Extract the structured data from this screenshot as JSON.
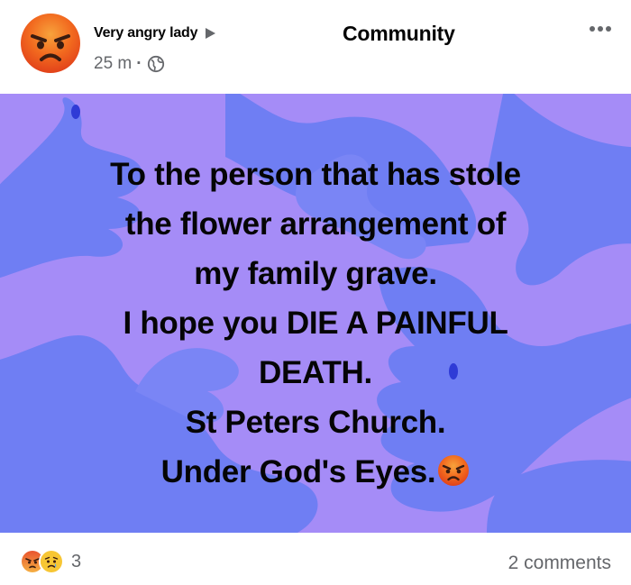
{
  "header": {
    "author_name": "Very angry lady",
    "group_name": "Community",
    "timestamp": "25 m",
    "meta_separator": "·",
    "avatar_icon": "angry-face-icon",
    "audience_icon": "globe-icon",
    "more_icon": "more-options-icon"
  },
  "post": {
    "background_color": "#a58cf7",
    "shape_color": "#6f7ef3",
    "lines": [
      "To the person that has stole",
      "the flower arrangement of",
      "my family grave.",
      "I hope you DIE A PAINFUL",
      "DEATH.",
      "St Peters Church.",
      "Under God's Eyes."
    ],
    "trailing_emoji": "angry-face-icon"
  },
  "footer": {
    "reaction_icons": [
      "angry-reaction-icon",
      "sad-reaction-icon"
    ],
    "reaction_count": "3",
    "comments_label": "2 comments"
  }
}
